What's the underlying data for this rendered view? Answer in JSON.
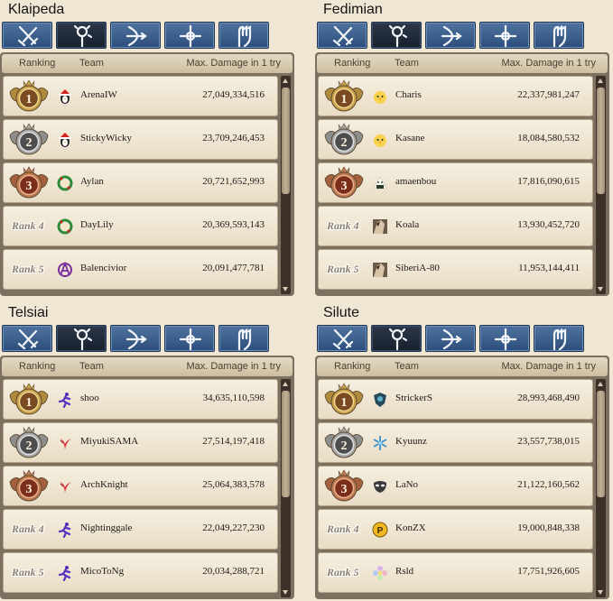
{
  "header": {
    "ranking": "Ranking",
    "team": "Team",
    "max_damage": "Max. Damage in 1 try"
  },
  "tabs": [
    {
      "icon": "swords-icon"
    },
    {
      "icon": "staff-icon"
    },
    {
      "icon": "bow-icon"
    },
    {
      "icon": "cross-icon"
    },
    {
      "icon": "fist-icon"
    }
  ],
  "active_tab_index": 1,
  "colors": {
    "tab": "#3d5f8c",
    "tab_active": "#1f2937",
    "board": "#7d7060",
    "row": "#f2eadb",
    "gold": "#c79a3c",
    "silver": "#9a9a9a",
    "bronze": "#a9603e"
  },
  "servers": [
    {
      "name": "Klaipeda",
      "entries": [
        {
          "rank_label": "1",
          "medal": "gold",
          "team": "ArenaIW",
          "team_icon": "penguin-santa-icon",
          "damage": "27,049,334,516"
        },
        {
          "rank_label": "2",
          "medal": "silver",
          "team": "StickyWicky",
          "team_icon": "penguin-santa-icon",
          "damage": "23,709,246,453"
        },
        {
          "rank_label": "3",
          "medal": "bronze",
          "team": "Aylan",
          "team_icon": "wreath-icon",
          "damage": "20,721,652,993"
        },
        {
          "rank_label": "Rank 4",
          "medal": "none",
          "team": "DayLily",
          "team_icon": "wreath-icon",
          "damage": "20,369,593,143"
        },
        {
          "rank_label": "Rank 5",
          "medal": "none",
          "team": "Balencivior",
          "team_icon": "anarchy-icon",
          "damage": "20,091,477,781"
        }
      ]
    },
    {
      "name": "Fedimian",
      "entries": [
        {
          "rank_label": "1",
          "medal": "gold",
          "team": "Charis",
          "team_icon": "chick-icon",
          "damage": "22,337,981,247"
        },
        {
          "rank_label": "2",
          "medal": "silver",
          "team": "Kasane",
          "team_icon": "chick-icon",
          "damage": "18,084,580,532"
        },
        {
          "rank_label": "3",
          "medal": "bronze",
          "team": "amaenbou",
          "team_icon": "onigiri-icon",
          "damage": "17,816,090,615"
        },
        {
          "rank_label": "Rank 4",
          "medal": "none",
          "team": "Koala",
          "team_icon": "portrait-icon",
          "damage": "13,930,452,720"
        },
        {
          "rank_label": "Rank 5",
          "medal": "none",
          "team": "SiberiA-80",
          "team_icon": "portrait-icon",
          "damage": "11,953,144,411"
        }
      ]
    },
    {
      "name": "Telsiai",
      "entries": [
        {
          "rank_label": "1",
          "medal": "gold",
          "team": "shoo",
          "team_icon": "running-figure-icon",
          "damage": "34,635,110,598"
        },
        {
          "rank_label": "2",
          "medal": "silver",
          "team": "MiyukiSAMA",
          "team_icon": "red-wing-icon",
          "damage": "27,514,197,418"
        },
        {
          "rank_label": "3",
          "medal": "bronze",
          "team": "ArchKnight",
          "team_icon": "red-wing-icon",
          "damage": "25,064,383,578"
        },
        {
          "rank_label": "Rank 4",
          "medal": "none",
          "team": "Nightinggale",
          "team_icon": "running-figure-icon",
          "damage": "22,049,227,230"
        },
        {
          "rank_label": "Rank 5",
          "medal": "none",
          "team": "MicoToNg",
          "team_icon": "running-figure-icon",
          "damage": "20,034,288,721"
        }
      ]
    },
    {
      "name": "Silute",
      "entries": [
        {
          "rank_label": "1",
          "medal": "gold",
          "team": "StrickerS",
          "team_icon": "shield-crest-icon",
          "damage": "28,993,468,490"
        },
        {
          "rank_label": "2",
          "medal": "silver",
          "team": "Kyuunz",
          "team_icon": "snowflake-icon",
          "damage": "23,557,738,015"
        },
        {
          "rank_label": "3",
          "medal": "bronze",
          "team": "LaNo",
          "team_icon": "mask-icon",
          "damage": "21,122,160,562"
        },
        {
          "rank_label": "Rank 4",
          "medal": "none",
          "team": "KonZX",
          "team_icon": "p-badge-icon",
          "damage": "19,000,848,338"
        },
        {
          "rank_label": "Rank 5",
          "medal": "none",
          "team": "Rsld",
          "team_icon": "flower-icon",
          "damage": "17,751,926,605"
        }
      ]
    }
  ]
}
